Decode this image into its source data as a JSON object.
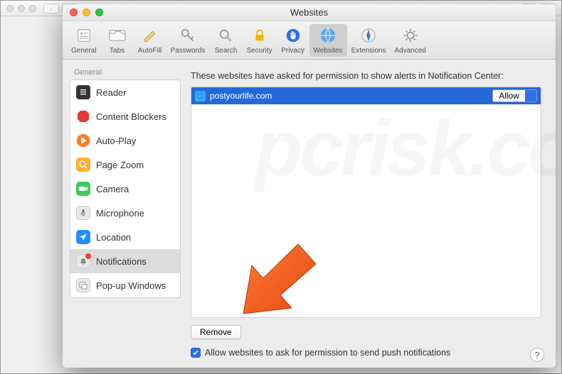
{
  "window": {
    "title": "Websites"
  },
  "toolbar": {
    "items": [
      {
        "label": "General"
      },
      {
        "label": "Tabs"
      },
      {
        "label": "AutoFill"
      },
      {
        "label": "Passwords"
      },
      {
        "label": "Search"
      },
      {
        "label": "Security"
      },
      {
        "label": "Privacy"
      },
      {
        "label": "Websites"
      },
      {
        "label": "Extensions"
      },
      {
        "label": "Advanced"
      }
    ]
  },
  "sidebar": {
    "header": "General",
    "items": [
      {
        "label": "Reader"
      },
      {
        "label": "Content Blockers"
      },
      {
        "label": "Auto-Play"
      },
      {
        "label": "Page Zoom"
      },
      {
        "label": "Camera"
      },
      {
        "label": "Microphone"
      },
      {
        "label": "Location"
      },
      {
        "label": "Notifications"
      },
      {
        "label": "Pop-up Windows"
      }
    ]
  },
  "main": {
    "description": "These websites have asked for permission to show alerts in Notification Center:",
    "site_domain": "postyourlife.com",
    "site_permission": "Allow",
    "remove_label": "Remove",
    "checkbox_label": "Allow websites to ask for permission to send push notifications",
    "help_label": "?"
  }
}
